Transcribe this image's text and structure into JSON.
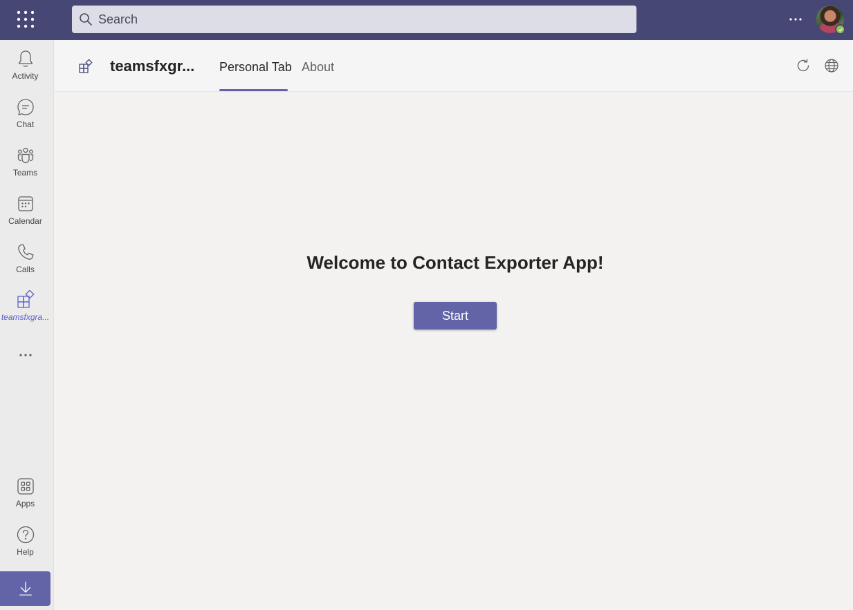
{
  "topbar": {
    "search_placeholder": "Search",
    "more_label": "···",
    "user_status": "available"
  },
  "rail": {
    "items": [
      {
        "label": "Activity",
        "icon": "bell-icon"
      },
      {
        "label": "Chat",
        "icon": "chat-icon"
      },
      {
        "label": "Teams",
        "icon": "teams-icon"
      },
      {
        "label": "Calendar",
        "icon": "calendar-icon"
      },
      {
        "label": "Calls",
        "icon": "phone-icon"
      },
      {
        "label": "teamsfxgra...",
        "icon": "app-icon",
        "active": true
      }
    ],
    "more_label": "···",
    "bottom_items": [
      {
        "label": "Apps",
        "icon": "apps-icon"
      },
      {
        "label": "Help",
        "icon": "help-icon"
      }
    ],
    "download_icon": "download-icon"
  },
  "header": {
    "app_name": "teamsfxgr...",
    "tabs": [
      {
        "label": "Personal Tab",
        "active": true
      },
      {
        "label": "About",
        "active": false
      }
    ]
  },
  "main": {
    "welcome": "Welcome to Contact Exporter App!",
    "start_label": "Start"
  },
  "colors": {
    "topbar": "#464775",
    "accent": "#6264a7",
    "rail_bg": "#ebebeb",
    "content_bg": "#f3f2f1",
    "presence": "#92c353"
  }
}
